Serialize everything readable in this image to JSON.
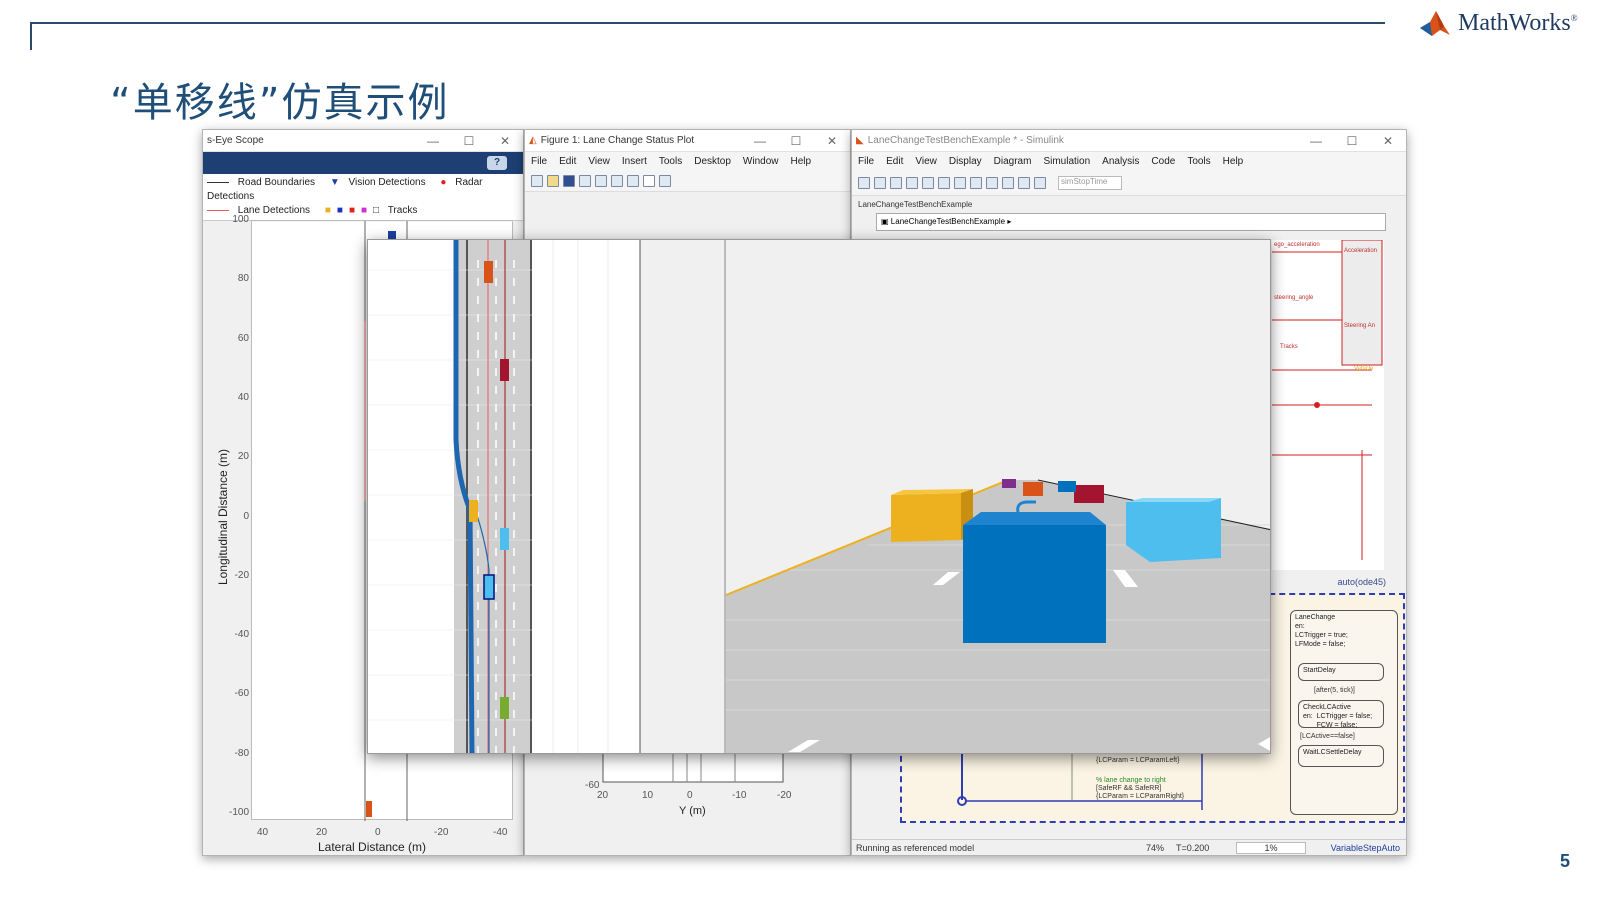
{
  "slide": {
    "title": "“单移线”仿真示例",
    "page_number": "5",
    "logo_text": "MathWorks",
    "logo_trademark": "®"
  },
  "bev_window": {
    "title": "s-Eye Scope",
    "help_label": "?",
    "legend": {
      "road_boundaries": "Road Boundaries",
      "vision_detections": "Vision Detections",
      "radar_detections": "Radar Detections",
      "lane_detections": "Lane Detections",
      "tracks": "Tracks"
    },
    "ylabel": "Longitudinal Distance (m)",
    "xlabel": "Lateral Distance (m)",
    "yticks": [
      "100",
      "80",
      "60",
      "40",
      "20",
      "0",
      "-20",
      "-40",
      "-60",
      "-80",
      "-100"
    ],
    "xticks": [
      "40",
      "20",
      "0",
      "-20",
      "-40"
    ]
  },
  "figure_window": {
    "title": "Figure 1: Lane Change Status Plot",
    "menu": [
      "File",
      "Edit",
      "View",
      "Insert",
      "Tools",
      "Desktop",
      "Window",
      "Help"
    ],
    "ytick_bottom": "-60",
    "xticks": [
      "20",
      "10",
      "0",
      "-10",
      "-20"
    ],
    "xlabel": "Y (m)"
  },
  "simulink_window": {
    "title": "LaneChangeTestBenchExample * - Simulink",
    "menu": [
      "File",
      "Edit",
      "View",
      "Display",
      "Diagram",
      "Simulation",
      "Analysis",
      "Code",
      "Tools",
      "Help"
    ],
    "stop_time_field": "simStopTime",
    "breadcrumb_tab": "LaneChangeTestBenchExample",
    "breadcrumb_path": "LaneChangeTestBenchExample",
    "signals": [
      "ego_acceleration",
      "Acceleration",
      "steering_angle",
      "Steering An",
      "Tracks",
      "Vehicle"
    ],
    "solver_label": "auto(ode45)",
    "stateflow": {
      "lanechange": "LaneChange\nen:\nLCTrigger = true;\nLFMode = false;",
      "startdelay": "StartDelay",
      "after": "[after(5, tick)]",
      "checklc": "CheckLCActive\nen:  LCTrigger = false;\n       FCW = false;",
      "lcactive": "[LCActive==false]",
      "waitlc": "WaitLCSettleDelay",
      "lcparam_left": "{LCParam = LCParamLeft}",
      "right_comment": "% lane change to right",
      "right_cond": "[SafeRF && SafeRR]",
      "right_action": "{LCParam = LCParamRight}"
    },
    "status": {
      "mode": "Running as referenced model",
      "zoom": "74%",
      "time": "T=0.200",
      "progress": "1%",
      "solver": "VariableStepAuto"
    }
  },
  "colors": {
    "title_blue": "#1f4e79",
    "ego_blue": "#0072bd",
    "orange": "#edb120",
    "light_blue": "#4dbeee",
    "red_car": "#a2142f",
    "orange_car": "#d95319",
    "purple_car": "#7e2f8e",
    "green_car": "#77ac30"
  }
}
